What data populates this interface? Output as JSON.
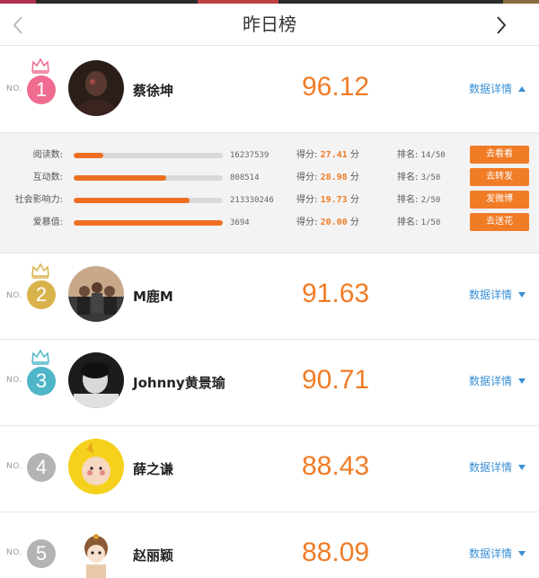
{
  "header": {
    "title": "昨日榜",
    "back_icon": "chevron-left-icon",
    "forward_icon": "chevron-right-icon"
  },
  "colors": {
    "accent": "#f07c26",
    "link": "#3a8fd5",
    "rank1": "#ef6b8f",
    "rank2": "#d8b24a",
    "rank3": "#4fb6c8",
    "rank_other": "#b3b3b3"
  },
  "no_label": "NO.",
  "rankings": [
    {
      "rank": "1",
      "name": "蔡徐坤",
      "score": "96.12",
      "detail_label": "数据详情",
      "expanded": true,
      "crown": true
    },
    {
      "rank": "2",
      "name": "M鹿M",
      "score": "91.63",
      "detail_label": "数据详情",
      "expanded": false,
      "crown": true
    },
    {
      "rank": "3",
      "name": "Johnny黄景瑜",
      "score": "90.71",
      "detail_label": "数据详情",
      "expanded": false,
      "crown": true
    },
    {
      "rank": "4",
      "name": "薛之谦",
      "score": "88.43",
      "detail_label": "数据详情",
      "expanded": false,
      "crown": false
    },
    {
      "rank": "5",
      "name": "赵丽颖",
      "score": "88.09",
      "detail_label": "数据详情",
      "expanded": false,
      "crown": false
    }
  ],
  "detail_panel": {
    "score_prefix": "得分:",
    "score_unit": "分",
    "rank_prefix": "排名:",
    "stats": [
      {
        "label": "阅读数:",
        "value": "16237539",
        "progress": 0.2,
        "score": "27.41",
        "rank": "14/50",
        "action": "去看看"
      },
      {
        "label": "互动数:",
        "value": "808514",
        "progress": 0.62,
        "score": "28.98",
        "rank": "3/50",
        "action": "去转发"
      },
      {
        "label": "社会影响力:",
        "value": "213330246",
        "progress": 0.78,
        "score": "19.73",
        "rank": "2/50",
        "action": "发微博"
      },
      {
        "label": "爱慕值:",
        "value": "3694",
        "progress": 1.0,
        "score": "20.00",
        "rank": "1/50",
        "action": "去送花"
      }
    ]
  }
}
